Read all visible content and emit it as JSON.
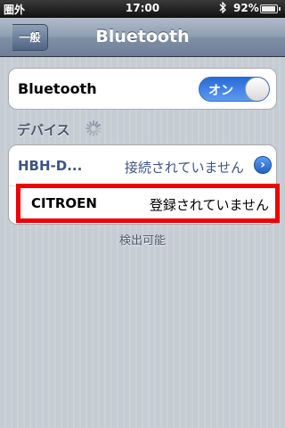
{
  "status_bar": {
    "carrier": "圏外",
    "time": "17:00",
    "bluetooth_icon": "bluetooth-icon",
    "battery_percent": "92%",
    "battery_level": 0.92
  },
  "nav": {
    "back_label": "一般",
    "title": "Bluetooth"
  },
  "bluetooth": {
    "label": "Bluetooth",
    "toggle_label": "オン",
    "enabled": true
  },
  "devices": {
    "header": "デバイス",
    "spinner_icon": "spinner-icon",
    "items": [
      {
        "name": "HBH-D...",
        "status": "接続されていません",
        "accessory_icon": "disclosure-arrow-icon"
      },
      {
        "name": "CITROEN",
        "status": "登録されていません"
      }
    ],
    "footer": "検出可能"
  },
  "colors": {
    "highlight": "#ee0000",
    "toggle_on": "#2a6ad8",
    "table_text": "#3c5582"
  }
}
